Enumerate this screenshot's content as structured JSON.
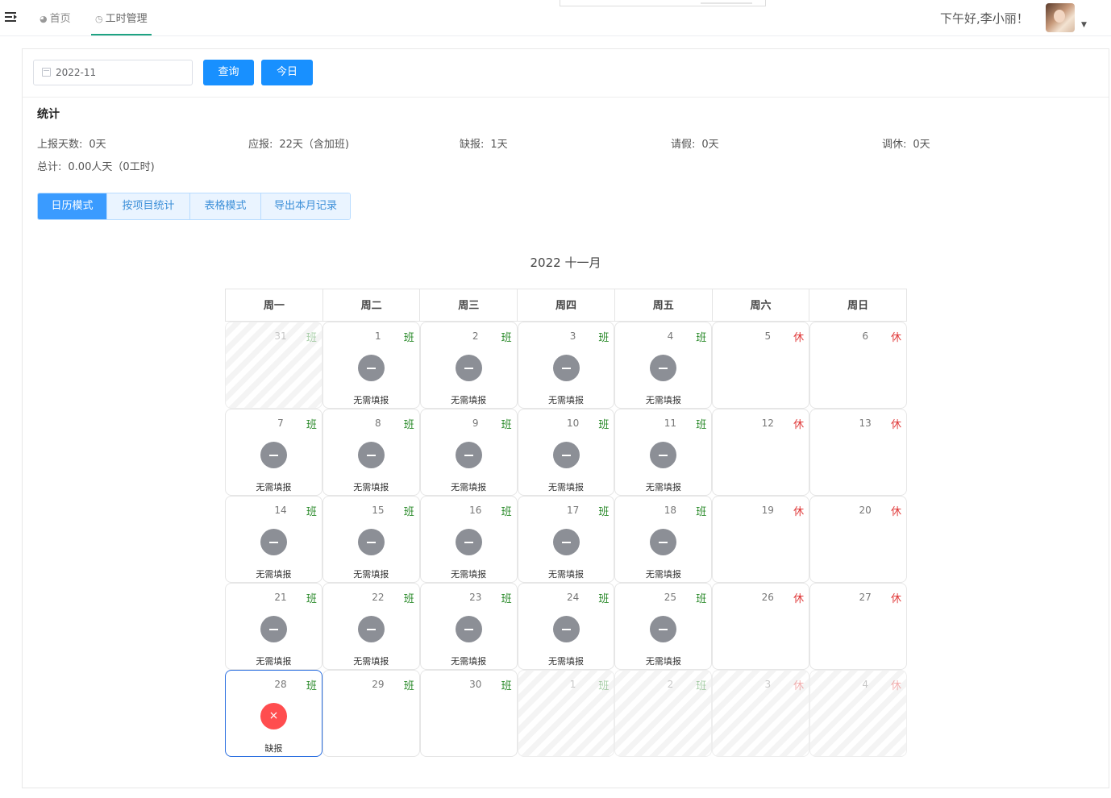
{
  "header": {
    "tabs": [
      {
        "icon": "dashboard-icon",
        "label": "首页"
      },
      {
        "icon": "clock-icon",
        "label": "工时管理"
      }
    ],
    "greeting": "下午好,李小丽！"
  },
  "filter": {
    "month_value": "2022-11",
    "query_label": "查询",
    "today_label": "今日"
  },
  "stats": {
    "title": "统计",
    "items": [
      {
        "label": "上报天数:",
        "value": "0天"
      },
      {
        "label": "应报:",
        "value": "22天（含加班)"
      },
      {
        "label": "缺报:",
        "value": "1天"
      },
      {
        "label": "请假:",
        "value": "0天"
      },
      {
        "label": "调休:",
        "value": "0天"
      }
    ],
    "total_label": "总计:",
    "total_value": "0.00人天（0工时)"
  },
  "modes": [
    "日历模式",
    "按项目统计",
    "表格模式",
    "导出本月记录"
  ],
  "active_mode": 0,
  "calendar": {
    "title": "2022 十一月",
    "weekdays": [
      "周一",
      "周二",
      "周三",
      "周四",
      "周五",
      "周六",
      "周日"
    ],
    "work_tag": "班",
    "rest_tag": "休",
    "weeks": [
      [
        {
          "day": "31",
          "tag": "班",
          "type": "work",
          "out": true
        },
        {
          "day": "1",
          "tag": "班",
          "type": "work",
          "status": "无需填报"
        },
        {
          "day": "2",
          "tag": "班",
          "type": "work",
          "status": "无需填报"
        },
        {
          "day": "3",
          "tag": "班",
          "type": "work",
          "status": "无需填报"
        },
        {
          "day": "4",
          "tag": "班",
          "type": "work",
          "status": "无需填报"
        },
        {
          "day": "5",
          "tag": "休",
          "type": "rest"
        },
        {
          "day": "6",
          "tag": "休",
          "type": "rest"
        }
      ],
      [
        {
          "day": "7",
          "tag": "班",
          "type": "work",
          "status": "无需填报"
        },
        {
          "day": "8",
          "tag": "班",
          "type": "work",
          "status": "无需填报"
        },
        {
          "day": "9",
          "tag": "班",
          "type": "work",
          "status": "无需填报"
        },
        {
          "day": "10",
          "tag": "班",
          "type": "work",
          "status": "无需填报"
        },
        {
          "day": "11",
          "tag": "班",
          "type": "work",
          "status": "无需填报"
        },
        {
          "day": "12",
          "tag": "休",
          "type": "rest"
        },
        {
          "day": "13",
          "tag": "休",
          "type": "rest"
        }
      ],
      [
        {
          "day": "14",
          "tag": "班",
          "type": "work",
          "status": "无需填报"
        },
        {
          "day": "15",
          "tag": "班",
          "type": "work",
          "status": "无需填报"
        },
        {
          "day": "16",
          "tag": "班",
          "type": "work",
          "status": "无需填报"
        },
        {
          "day": "17",
          "tag": "班",
          "type": "work",
          "status": "无需填报"
        },
        {
          "day": "18",
          "tag": "班",
          "type": "work",
          "status": "无需填报"
        },
        {
          "day": "19",
          "tag": "休",
          "type": "rest"
        },
        {
          "day": "20",
          "tag": "休",
          "type": "rest"
        }
      ],
      [
        {
          "day": "21",
          "tag": "班",
          "type": "work",
          "status": "无需填报"
        },
        {
          "day": "22",
          "tag": "班",
          "type": "work",
          "status": "无需填报"
        },
        {
          "day": "23",
          "tag": "班",
          "type": "work",
          "status": "无需填报"
        },
        {
          "day": "24",
          "tag": "班",
          "type": "work",
          "status": "无需填报"
        },
        {
          "day": "25",
          "tag": "班",
          "type": "work",
          "status": "无需填报"
        },
        {
          "day": "26",
          "tag": "休",
          "type": "rest"
        },
        {
          "day": "27",
          "tag": "休",
          "type": "rest"
        }
      ],
      [
        {
          "day": "28",
          "tag": "班",
          "type": "work",
          "status": "缺报",
          "missing": true,
          "selected": true
        },
        {
          "day": "29",
          "tag": "班",
          "type": "work"
        },
        {
          "day": "30",
          "tag": "班",
          "type": "work"
        },
        {
          "day": "1",
          "tag": "班",
          "type": "work",
          "out": true
        },
        {
          "day": "2",
          "tag": "班",
          "type": "work",
          "out": true
        },
        {
          "day": "3",
          "tag": "休",
          "type": "rest",
          "out": true
        },
        {
          "day": "4",
          "tag": "休",
          "type": "rest",
          "out": true
        }
      ]
    ]
  }
}
